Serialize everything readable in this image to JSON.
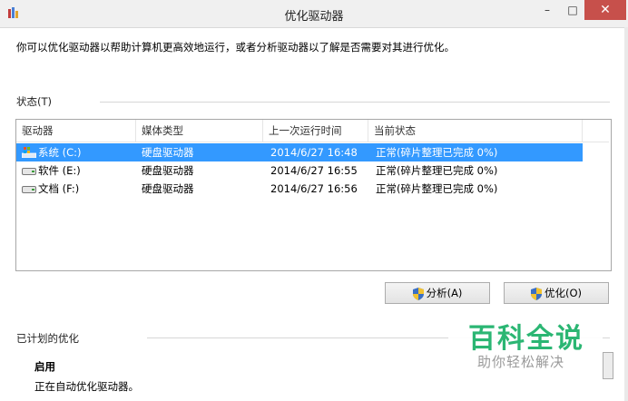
{
  "window": {
    "title": "优化驱动器",
    "minimize_glyph": "–",
    "maximize_glyph": "□",
    "close_glyph": "✕"
  },
  "description": "你可以优化驱动器以帮助计算机更高效地运行，或者分析驱动器以了解是否需要对其进行优化。",
  "status_section": {
    "label": "状态(T)",
    "columns": [
      "驱动器",
      "媒体类型",
      "上一次运行时间",
      "当前状态"
    ],
    "rows": [
      {
        "drive": "系统 (C:)",
        "media": "硬盘驱动器",
        "last_run": "2014/6/27 16:48",
        "status": "正常(碎片整理已完成 0%)",
        "selected": true,
        "icon": "system-drive-icon"
      },
      {
        "drive": "软件 (E:)",
        "media": "硬盘驱动器",
        "last_run": "2014/6/27 16:55",
        "status": "正常(碎片整理已完成 0%)",
        "selected": false,
        "icon": "hard-drive-icon"
      },
      {
        "drive": "文档 (F:)",
        "media": "硬盘驱动器",
        "last_run": "2014/6/27 16:56",
        "status": "正常(碎片整理已完成 0%)",
        "selected": false,
        "icon": "hard-drive-icon"
      }
    ]
  },
  "buttons": {
    "analyze": "分析(A)",
    "optimize": "优化(O)"
  },
  "scheduled_section": {
    "label": "已计划的优化",
    "state": "启用",
    "detail": "正在自动优化驱动器。"
  },
  "watermark": {
    "main": "百科全说",
    "sub": "助你轻松解决"
  },
  "colors": {
    "selection": "#3399ff",
    "close_button": "#c7504b",
    "watermark_green": "#2bb673"
  }
}
